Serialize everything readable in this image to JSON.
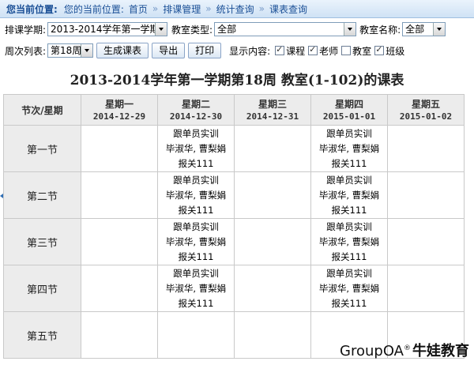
{
  "breadcrumb": {
    "label": "您当前位置:",
    "prefix": "您的当前位置:",
    "items": [
      "首页",
      "排课管理",
      "统计查询",
      "课表查询"
    ],
    "separator": "»"
  },
  "filters": {
    "term_label": "排课学期:",
    "term_value": "2013-2014学年第一学期",
    "room_type_label": "教室类型:",
    "room_type_value": "全部",
    "room_name_label": "教室名称:",
    "room_name_value": "全部",
    "week_label": "周次列表:",
    "week_value": "第18周",
    "generate_button": "生成课表",
    "export_button": "导出",
    "print_button": "打印",
    "display_label": "显示内容:",
    "options": [
      {
        "label": "课程",
        "checked": true
      },
      {
        "label": "老师",
        "checked": true
      },
      {
        "label": "教室",
        "checked": false
      },
      {
        "label": "班级",
        "checked": true
      }
    ]
  },
  "schedule": {
    "title": "2013-2014学年第一学期第18周 教室(1-102)的课表",
    "corner_header": "节次/星期",
    "days": [
      {
        "name": "星期一",
        "date": "2014-12-29"
      },
      {
        "name": "星期二",
        "date": "2014-12-30"
      },
      {
        "name": "星期三",
        "date": "2014-12-31"
      },
      {
        "name": "星期四",
        "date": "2015-01-01"
      },
      {
        "name": "星期五",
        "date": "2015-01-02"
      }
    ],
    "slots": [
      "第一节",
      "第二节",
      "第三节",
      "第四节",
      "第五节"
    ],
    "course": {
      "name": "跟单员实训",
      "teachers": "毕淑华, 曹梨娟",
      "class": "报关111"
    }
  },
  "watermark": {
    "brand": "GroupOA",
    "reg": "®",
    "cn": "牛娃教育"
  }
}
